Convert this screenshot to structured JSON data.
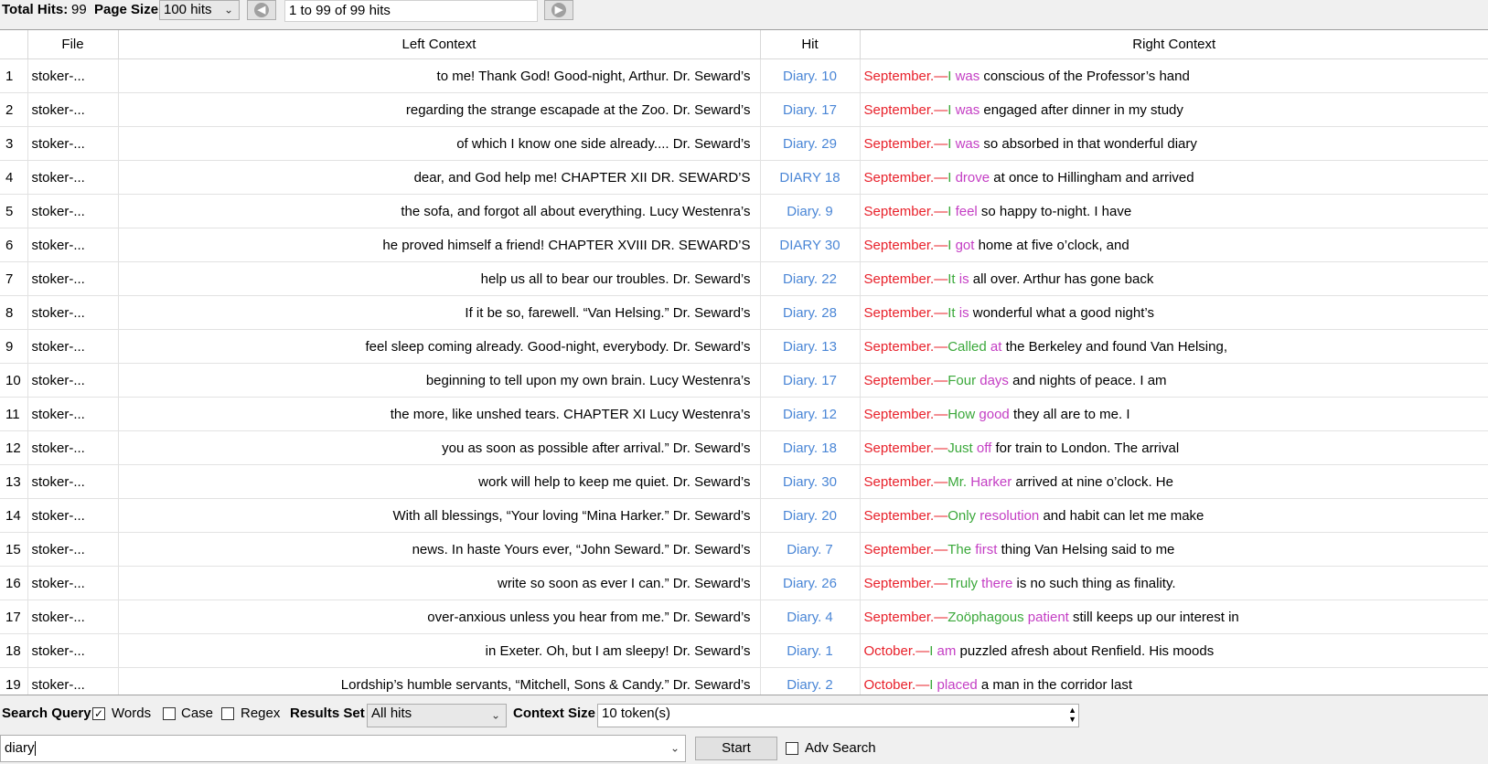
{
  "toolbar": {
    "total_hits_label": "Total Hits:",
    "total_hits_value": "99",
    "page_size_label": "Page Size",
    "page_size_value": "100 hits",
    "range_text": "1 to 99 of 99 hits"
  },
  "table": {
    "columns": [
      "File",
      "Left Context",
      "Hit",
      "Right Context"
    ],
    "rows": [
      {
        "n": "1",
        "file": "stoker-...",
        "left": "to me! Thank God! Good-night, Arthur. Dr. Seward’s",
        "hit": "Diary. 10",
        "right": [
          [
            "r",
            "September.—"
          ],
          [
            "g",
            "I "
          ],
          [
            "m",
            "was"
          ],
          [
            "k",
            " conscious of the Professor’s hand"
          ]
        ]
      },
      {
        "n": "2",
        "file": "stoker-...",
        "left": "regarding the strange escapade at the Zoo. Dr. Seward’s",
        "hit": "Diary. 17",
        "right": [
          [
            "r",
            "September.—"
          ],
          [
            "g",
            "I "
          ],
          [
            "m",
            "was"
          ],
          [
            "k",
            " engaged after dinner in my study"
          ]
        ]
      },
      {
        "n": "3",
        "file": "stoker-...",
        "left": "of which I know one side already.... Dr. Seward’s",
        "hit": "Diary. 29",
        "right": [
          [
            "r",
            "September.—"
          ],
          [
            "g",
            "I "
          ],
          [
            "m",
            "was"
          ],
          [
            "k",
            " so absorbed in that wonderful diary"
          ]
        ]
      },
      {
        "n": "4",
        "file": "stoker-...",
        "left": "dear, and God help me! CHAPTER XII DR. SEWARD’S",
        "hit": "DIARY 18",
        "right": [
          [
            "r",
            "September.—"
          ],
          [
            "g",
            "I "
          ],
          [
            "m",
            "drove"
          ],
          [
            "k",
            " at once to Hillingham and arrived"
          ]
        ]
      },
      {
        "n": "5",
        "file": "stoker-...",
        "left": "the sofa, and forgot all about everything. Lucy Westenra’s",
        "hit": "Diary. 9",
        "right": [
          [
            "r",
            "September.—"
          ],
          [
            "g",
            "I "
          ],
          [
            "m",
            "feel"
          ],
          [
            "k",
            " so happy to-night. I have"
          ]
        ]
      },
      {
        "n": "6",
        "file": "stoker-...",
        "left": "he proved himself a friend! CHAPTER XVIII DR. SEWARD’S",
        "hit": "DIARY 30",
        "right": [
          [
            "r",
            "September.—"
          ],
          [
            "g",
            "I "
          ],
          [
            "m",
            "got"
          ],
          [
            "k",
            " home at five o’clock, and"
          ]
        ]
      },
      {
        "n": "7",
        "file": "stoker-...",
        "left": "help us all to bear our troubles. Dr. Seward’s",
        "hit": "Diary. 22",
        "right": [
          [
            "r",
            "September.—"
          ],
          [
            "g",
            "It "
          ],
          [
            "m",
            "is"
          ],
          [
            "k",
            " all over. Arthur has gone back"
          ]
        ]
      },
      {
        "n": "8",
        "file": "stoker-...",
        "left": "If it be so, farewell. “Van Helsing.” Dr. Seward’s",
        "hit": "Diary. 28",
        "right": [
          [
            "r",
            "September.—"
          ],
          [
            "g",
            "It "
          ],
          [
            "m",
            "is"
          ],
          [
            "k",
            " wonderful what a good night’s"
          ]
        ]
      },
      {
        "n": "9",
        "file": "stoker-...",
        "left": "feel sleep coming already. Good-night, everybody. Dr. Seward’s",
        "hit": "Diary. 13",
        "right": [
          [
            "r",
            "September.—"
          ],
          [
            "g",
            "Called "
          ],
          [
            "m",
            "at"
          ],
          [
            "k",
            " the Berkeley and found Van Helsing,"
          ]
        ]
      },
      {
        "n": "10",
        "file": "stoker-...",
        "left": "beginning to tell upon my own brain. Lucy Westenra’s",
        "hit": "Diary. 17",
        "right": [
          [
            "r",
            "September.—"
          ],
          [
            "g",
            "Four "
          ],
          [
            "m",
            "days"
          ],
          [
            "k",
            " and nights of peace. I am"
          ]
        ]
      },
      {
        "n": "11",
        "file": "stoker-...",
        "left": "the more, like unshed tears. CHAPTER XI Lucy Westenra’s",
        "hit": "Diary. 12",
        "right": [
          [
            "r",
            "September.—"
          ],
          [
            "g",
            "How "
          ],
          [
            "m",
            "good"
          ],
          [
            "k",
            " they all are to me. I"
          ]
        ]
      },
      {
        "n": "12",
        "file": "stoker-...",
        "left": "you as soon as possible after arrival.” Dr. Seward’s",
        "hit": "Diary. 18",
        "right": [
          [
            "r",
            "September.—"
          ],
          [
            "g",
            "Just "
          ],
          [
            "m",
            "off"
          ],
          [
            "k",
            " for train to London. The arrival"
          ]
        ]
      },
      {
        "n": "13",
        "file": "stoker-...",
        "left": "work will help to keep me quiet. Dr. Seward’s",
        "hit": "Diary. 30",
        "right": [
          [
            "r",
            "September.—"
          ],
          [
            "g",
            "Mr. "
          ],
          [
            "m",
            "Harker"
          ],
          [
            "k",
            " arrived at nine o’clock. He"
          ]
        ]
      },
      {
        "n": "14",
        "file": "stoker-...",
        "left": "With all blessings, “Your loving “Mina Harker.” Dr. Seward’s",
        "hit": "Diary. 20",
        "right": [
          [
            "r",
            "September.—"
          ],
          [
            "g",
            "Only "
          ],
          [
            "m",
            "resolution"
          ],
          [
            "k",
            " and habit can let me make"
          ]
        ]
      },
      {
        "n": "15",
        "file": "stoker-...",
        "left": "news. In haste Yours ever, “John Seward.” Dr. Seward’s",
        "hit": "Diary. 7",
        "right": [
          [
            "r",
            "September.—"
          ],
          [
            "g",
            "The "
          ],
          [
            "m",
            "first"
          ],
          [
            "k",
            " thing Van Helsing said to me"
          ]
        ]
      },
      {
        "n": "16",
        "file": "stoker-...",
        "left": "write so soon as ever I can.” Dr. Seward’s",
        "hit": "Diary. 26",
        "right": [
          [
            "r",
            "September.—"
          ],
          [
            "g",
            "Truly "
          ],
          [
            "m",
            "there"
          ],
          [
            "k",
            " is no such thing as finality."
          ]
        ]
      },
      {
        "n": "17",
        "file": "stoker-...",
        "left": "over-anxious unless you hear from me.” Dr. Seward’s",
        "hit": "Diary. 4",
        "right": [
          [
            "r",
            "September.—"
          ],
          [
            "g",
            "Zoöphagous "
          ],
          [
            "m",
            "patient"
          ],
          [
            "k",
            " still keeps up our interest in"
          ]
        ]
      },
      {
        "n": "18",
        "file": "stoker-...",
        "left": "in Exeter. Oh, but I am sleepy! Dr. Seward’s",
        "hit": "Diary. 1",
        "right": [
          [
            "r",
            "October.—"
          ],
          [
            "g",
            "I "
          ],
          [
            "m",
            "am"
          ],
          [
            "k",
            " puzzled afresh about Renfield. His moods"
          ]
        ]
      },
      {
        "n": "19",
        "file": "stoker-...",
        "left": "Lordship’s humble servants, “Mitchell, Sons & Candy.” Dr. Seward’s",
        "hit": "Diary. 2",
        "right": [
          [
            "r",
            "October.—"
          ],
          [
            "g",
            "I "
          ],
          [
            "m",
            "placed"
          ],
          [
            "k",
            " a man in the corridor last"
          ]
        ]
      }
    ]
  },
  "search": {
    "query_label": "Search Query",
    "words_label": "Words",
    "case_label": "Case",
    "regex_label": "Regex",
    "results_set_label": "Results Set",
    "results_set_value": "All hits",
    "context_size_label": "Context Size",
    "context_size_value": "10 token(s)",
    "query_value": "diary",
    "start_label": "Start",
    "adv_search_label": "Adv Search"
  },
  "colors": {
    "context_prefix": "#e8202a",
    "first_word": "#3aa83a",
    "second_word": "#c43ec4",
    "hit": "#4a86d6"
  }
}
